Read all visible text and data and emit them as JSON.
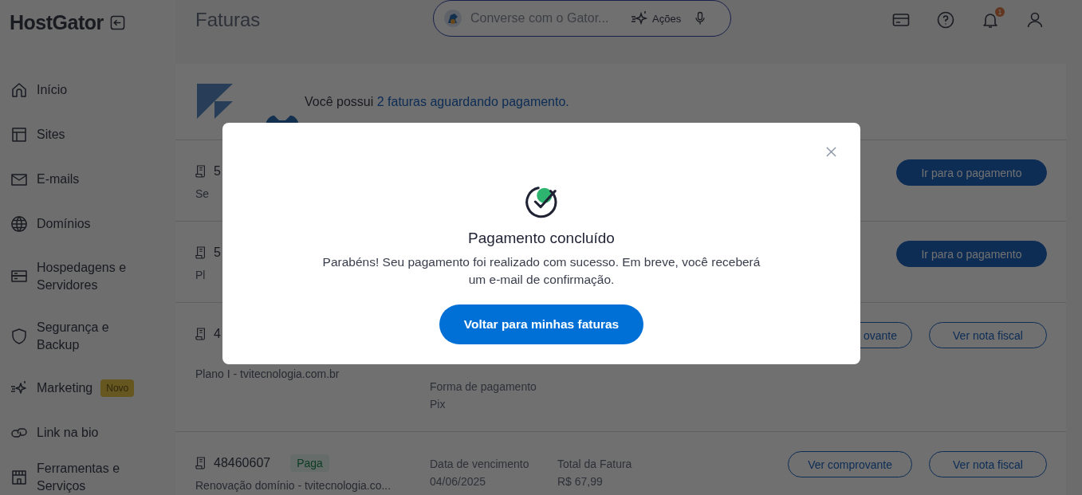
{
  "brand": {
    "logo": "HostGator"
  },
  "sidebar": {
    "items": [
      {
        "label": "Início"
      },
      {
        "label": "Sites"
      },
      {
        "label": "E-mails"
      },
      {
        "label": "Domínios"
      },
      {
        "label": "Hospedagens e Servidores"
      },
      {
        "label": "Segurança e Backup"
      },
      {
        "label": "Marketing",
        "badge": "Novo"
      },
      {
        "label": "Link na bio"
      },
      {
        "label": "Ferramentas e Serviços"
      }
    ]
  },
  "header": {
    "title": "Faturas",
    "search": {
      "placeholder": "Converse com o Gator...",
      "actions": "Ações"
    },
    "notification_count": "1"
  },
  "banner": {
    "text": "Você possui",
    "link": "2 faturas aguardando pagamento."
  },
  "invoices": [
    {
      "id": "5",
      "description": "Se",
      "actions": [
        {
          "label": "Ir para o pagamento",
          "kind": "primary"
        }
      ]
    },
    {
      "id": "5",
      "description": "Pl",
      "actions": [
        {
          "label": "Ir para o pagamento",
          "kind": "primary"
        }
      ]
    },
    {
      "id": "4",
      "description": "Plano I - tvitecnologia.com.br",
      "details": [
        {
          "label": "Forma de pagamento",
          "value": "Pix"
        }
      ],
      "actions": [
        {
          "label": "ovante",
          "kind": "outline"
        },
        {
          "label": "Ver nota fiscal",
          "kind": "outline"
        }
      ]
    },
    {
      "id": "48460607",
      "status": "Paga",
      "description": "Renovação domínio - tvitecnologia.co...",
      "details": [
        {
          "label": "Data de vencimento",
          "value": "04/06/2025"
        },
        {
          "label": "Total da Fatura",
          "value": "R$ 67,99"
        }
      ],
      "actions": [
        {
          "label": "Ver comprovante",
          "kind": "outline"
        },
        {
          "label": "Ver nota fiscal",
          "kind": "outline"
        }
      ]
    }
  ],
  "modal": {
    "title": "Pagamento concluído",
    "message": "Parabéns! Seu pagamento foi realizado com sucesso. Em breve, você receberá um e-mail de confirmação.",
    "button": "Voltar para minhas faturas"
  }
}
